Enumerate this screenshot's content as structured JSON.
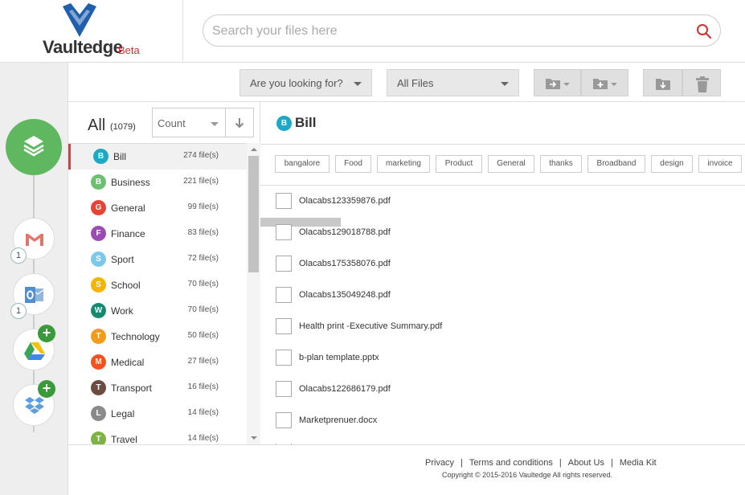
{
  "app": {
    "name": "Vaultedge",
    "badge": "Beta"
  },
  "search": {
    "placeholder": "Search your files here",
    "icon": "search-icon"
  },
  "toolbar": {
    "type_filter": "Are you looking for?",
    "file_filter": "All Files",
    "buttons": [
      "move-to-folder-icon",
      "add-folder-icon",
      "download-icon",
      "delete-icon"
    ]
  },
  "sources": [
    {
      "name": "gmail",
      "badge": "1"
    },
    {
      "name": "outlook",
      "badge": "1"
    },
    {
      "name": "google-drive",
      "badge": "+"
    },
    {
      "name": "dropbox",
      "badge": "+"
    }
  ],
  "categories": {
    "header": "All",
    "total": "(1079)",
    "sort_label": "Count",
    "items": [
      {
        "letter": "B",
        "name": "Bill",
        "count": "274 file(s)",
        "color": "#1fa7c8"
      },
      {
        "letter": "B",
        "name": "Business",
        "count": "221 file(s)",
        "color": "#6dbf71"
      },
      {
        "letter": "G",
        "name": "General",
        "count": "99 file(s)",
        "color": "#e84236"
      },
      {
        "letter": "F",
        "name": "Finance",
        "count": "83 file(s)",
        "color": "#9c4bb5"
      },
      {
        "letter": "S",
        "name": "Sport",
        "count": "72 file(s)",
        "color": "#7cc9ec"
      },
      {
        "letter": "S",
        "name": "School",
        "count": "70 file(s)",
        "color": "#f4b400"
      },
      {
        "letter": "W",
        "name": "Work",
        "count": "70 file(s)",
        "color": "#158a6e"
      },
      {
        "letter": "T",
        "name": "Technology",
        "count": "50 file(s)",
        "color": "#f59b1a"
      },
      {
        "letter": "M",
        "name": "Medical",
        "count": "27 file(s)",
        "color": "#f4511e"
      },
      {
        "letter": "T",
        "name": "Transport",
        "count": "16 file(s)",
        "color": "#6d4c41"
      },
      {
        "letter": "L",
        "name": "Legal",
        "count": "14 file(s)",
        "color": "#8a8a8a"
      },
      {
        "letter": "T",
        "name": "Travel",
        "count": "14 file(s)",
        "color": "#7cb342"
      }
    ]
  },
  "selected_category": {
    "letter": "B",
    "name": "Bill"
  },
  "tags": [
    "bangalore",
    "Food",
    "marketing",
    "Product",
    "General",
    "thanks",
    "Broadband",
    "design",
    "invoice"
  ],
  "files": [
    "Olacabs123359876.pdf",
    "Olacabs129018788.pdf",
    "Olacabs175358076.pdf",
    "Olacabs135049248.pdf",
    "Health print -Executive Summary.pdf",
    "b-plan template.pptx",
    "Olacabs122686179.pdf",
    "Marketprenuer.docx"
  ],
  "footer": {
    "links": [
      "Privacy",
      "Terms and conditions",
      "About Us",
      "Media Kit"
    ],
    "copyright": "Copyright © 2015-2016 Vaultedge All rights reserved."
  }
}
